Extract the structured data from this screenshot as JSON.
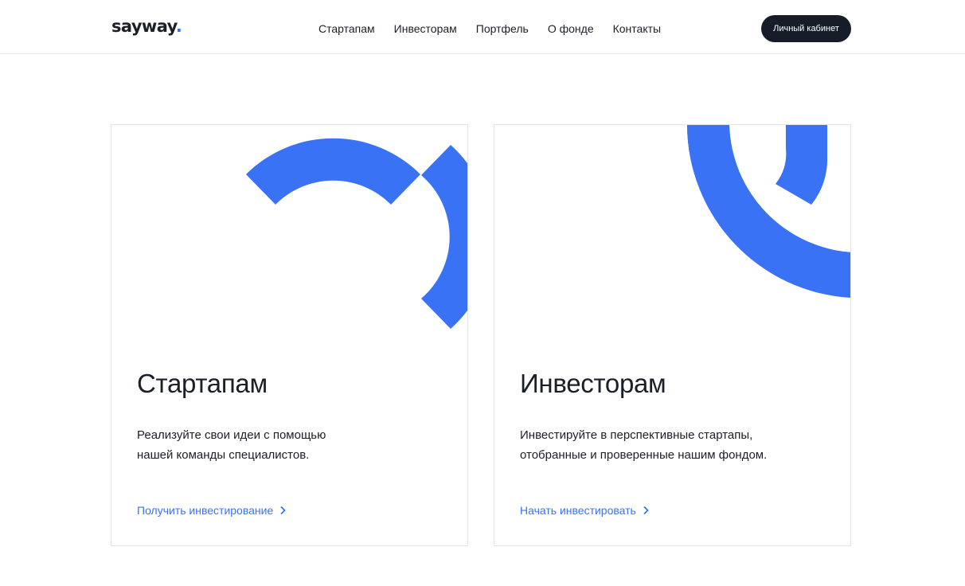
{
  "header": {
    "logo_text": "sayway",
    "logo_dot": ".",
    "nav": [
      "Стартапам",
      "Инвесторам",
      "Портфель",
      "О фонде",
      "Контакты"
    ],
    "cabinet_button": "Личный кабинет"
  },
  "cards": [
    {
      "title": "Стартапам",
      "description_lines": [
        "Реализуйте свои идеи с помощью",
        "нашей команды специалистов."
      ],
      "link": "Получить инвестирование",
      "link_icon": "chevron-right-icon"
    },
    {
      "title": "Инвесторам",
      "description_lines": [
        "Инвестируйте в перспективные стартапы,",
        "отобранные и проверенные нашим фондом."
      ],
      "link": "Начать инвестировать",
      "link_icon": "chevron-right-icon"
    }
  ],
  "colors": {
    "accent": "#3a72f5",
    "text": "#1b1f27",
    "button_bg": "#161d29",
    "border": "#e2e4e8"
  }
}
